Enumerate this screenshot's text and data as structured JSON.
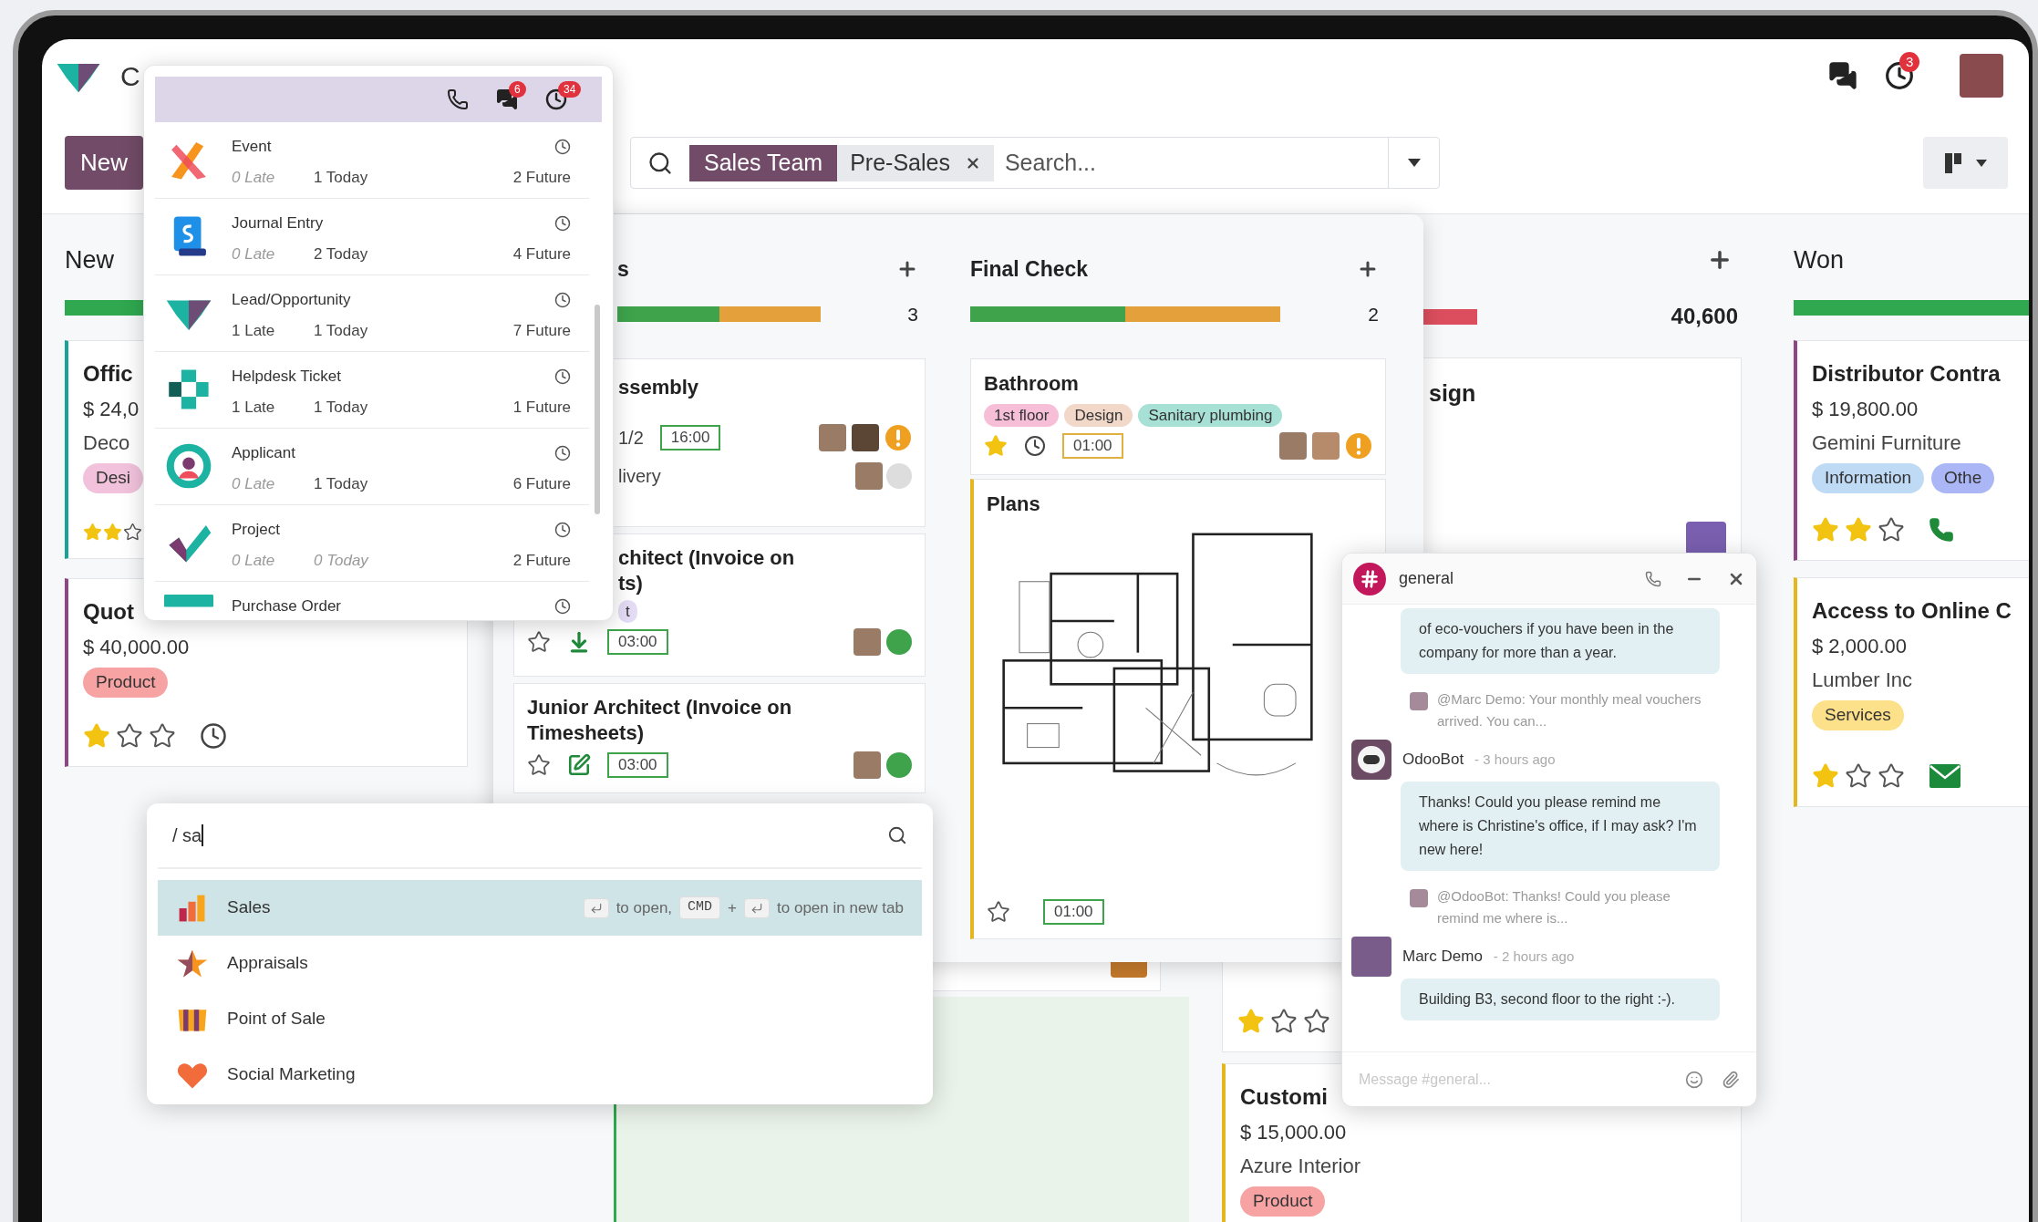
{
  "navbar": {
    "app_name": "C",
    "activity_badge": "3"
  },
  "control_panel": {
    "new_button": "New",
    "facet_field": "Sales Team",
    "facet_value": "Pre-Sales",
    "search_placeholder": "Search..."
  },
  "pipeline": {
    "new_column": {
      "title": "New",
      "progress": [
        {
          "color": "#2fa84f"
        }
      ],
      "cards": [
        {
          "title": "Offic",
          "amount": "$ 24,0",
          "customer": "Deco",
          "tags": [
            {
              "label": "Desi",
              "color": "#f2c2dc"
            }
          ],
          "stars": 2,
          "color": "#17a398"
        },
        {
          "title": "Quot",
          "amount": "$ 40,000.00",
          "tags": [
            {
              "label": "Product",
              "color": "#f7a3a3"
            }
          ],
          "stars": 1,
          "color": "#8e4585",
          "kind": "clock"
        }
      ]
    },
    "fourth_column": {
      "count": "40,600",
      "progress": [
        {
          "color": "#dc4e5e"
        }
      ],
      "cards": [
        {
          "title": "sign"
        },
        {
          "stars": 1
        },
        {
          "title": "Customi",
          "amount": "$ 15,000.00",
          "customer": "Azure Interior",
          "tags": [
            {
              "label": "Product",
              "color": "#f7a3a3"
            }
          ],
          "color": "#e3b71d"
        }
      ]
    },
    "won_column": {
      "title": "Won",
      "progress": [
        {
          "color": "#2fa84f"
        }
      ],
      "cards": [
        {
          "title": "Distributor Contra",
          "amount": "$ 19,800.00",
          "customer": "Gemini Furniture",
          "tags": [
            {
              "label": "Information",
              "color": "#bfdaf5"
            },
            {
              "label": "Othe",
              "color": "#aab6f6"
            }
          ],
          "stars": 2,
          "color": "#8e4585",
          "kind": "phone"
        },
        {
          "title": "Access to Online C",
          "amount": "$ 2,000.00",
          "customer": "Lumber Inc",
          "tags": [
            {
              "label": "Services",
              "color": "#fde08a"
            }
          ],
          "stars": 1,
          "color": "#e3b71d",
          "kind": "mail"
        }
      ]
    }
  },
  "activity_popup": {
    "chat_badge": "6",
    "activity_badge": "34",
    "rows": [
      {
        "kind": "event",
        "name": "Event",
        "late": {
          "text": "0 Late",
          "muted": true
        },
        "today": {
          "text": "1 Today",
          "muted": false
        },
        "future": "2 Future"
      },
      {
        "kind": "journal",
        "name": "Journal Entry",
        "late": {
          "text": "0 Late",
          "muted": true
        },
        "today": {
          "text": "2 Today",
          "muted": false
        },
        "future": "4 Future"
      },
      {
        "kind": "lead",
        "name": "Lead/Opportunity",
        "late": {
          "text": "1 Late",
          "muted": false
        },
        "today": {
          "text": "1 Today",
          "muted": false
        },
        "future": "7 Future"
      },
      {
        "kind": "helpdesk",
        "name": "Helpdesk Ticket",
        "late": {
          "text": "1 Late",
          "muted": false
        },
        "today": {
          "text": "1 Today",
          "muted": false
        },
        "future": "1 Future"
      },
      {
        "kind": "applicant",
        "name": "Applicant",
        "late": {
          "text": "0 Late",
          "muted": true
        },
        "today": {
          "text": "1 Today",
          "muted": false
        },
        "future": "6 Future"
      },
      {
        "kind": "project",
        "name": "Project",
        "late": {
          "text": "0 Late",
          "muted": true
        },
        "today": {
          "text": "0 Today",
          "muted": true
        },
        "future": "2 Future"
      },
      {
        "kind": "purchase",
        "name": "Purchase Order"
      }
    ]
  },
  "project_board": {
    "columns": [
      {
        "title": "s",
        "count": "3",
        "progress": [
          {
            "color": "#3ea34b",
            "level": 0.5
          },
          {
            "color": "#e4a03a",
            "level": 0.5
          }
        ]
      },
      {
        "title": "Final Check",
        "count": "2",
        "progress": [
          {
            "color": "#3ea34b",
            "level": 0.5
          },
          {
            "color": "#e4a03a",
            "level": 0.5
          }
        ]
      }
    ],
    "assembly_card": {
      "title": "ssembly",
      "subtasks": "1/2",
      "time": {
        "text": "16:00",
        "color": "#3ea34b"
      },
      "subtask": {
        "name": "livery",
        "color": "#dddddd"
      }
    },
    "architect_card": {
      "title_lines": [
        "chitect (Invoice on",
        "ts)"
      ],
      "tags": [
        {
          "label": "t",
          "color": "#e4dbf5"
        }
      ],
      "starred": false,
      "time": {
        "text": "03:00",
        "color": "#3ea34b"
      },
      "state": {
        "color": "#3ea34b"
      }
    },
    "junior_card": {
      "title_lines": [
        "Junior Architect (Invoice on",
        "Timesheets)"
      ],
      "starred": false,
      "time": {
        "text": "03:00",
        "color": "#3ea34b"
      },
      "state": {
        "color": "#3ea34b"
      }
    },
    "bathroom_card": {
      "title": "Bathroom",
      "tags": [
        {
          "label": "1st floor",
          "color": "#f6bfd7"
        },
        {
          "label": "Design",
          "color": "#f2d8c8"
        },
        {
          "label": "Sanitary plumbing",
          "color": "#a7e1d6"
        }
      ],
      "starred": true,
      "time": {
        "text": "01:00",
        "color": "#e0b040"
      }
    },
    "plans_card": {
      "title": "Plans",
      "color": "#e3b71d",
      "starred": false,
      "time": {
        "text": "01:00",
        "color": "#3ea34b"
      }
    }
  },
  "command_palette": {
    "query": "/ sa",
    "hint": {
      "open": "to open,",
      "modifier": "CMD",
      "plus": "+",
      "new_tab": "to open in new tab"
    },
    "items": [
      {
        "kind": "sales",
        "label": "Sales",
        "selected": true
      },
      {
        "kind": "appraisals",
        "label": "Appraisals",
        "selected": false
      },
      {
        "kind": "pos",
        "label": "Point of Sale",
        "selected": false
      },
      {
        "kind": "social",
        "label": "Social Marketing",
        "selected": false
      }
    ]
  },
  "chat_window": {
    "channel": "general",
    "composer_placeholder": "Message #general...",
    "messages": [
      {
        "kind": "bubble",
        "text": "of eco-vouchers if you have been in the company for more than a year."
      },
      {
        "kind": "reply",
        "text": "@Marc Demo:  Your monthly meal vouchers arrived. You can..."
      },
      {
        "kind": "author",
        "bot": true,
        "name": "OdooBot",
        "time": "- 3 hours ago"
      },
      {
        "kind": "bubble",
        "text": "Thanks! Could you please remind me where is Christine's office, if I may ask? I'm new here!"
      },
      {
        "kind": "reply",
        "text": "@OdooBot:  Thanks! Could you please remind me where is..."
      },
      {
        "kind": "author",
        "bot": false,
        "name": "Marc Demo",
        "time": "- 2 hours ago"
      },
      {
        "kind": "bubble",
        "text": "Building B3, second floor to the right :-)."
      }
    ]
  }
}
